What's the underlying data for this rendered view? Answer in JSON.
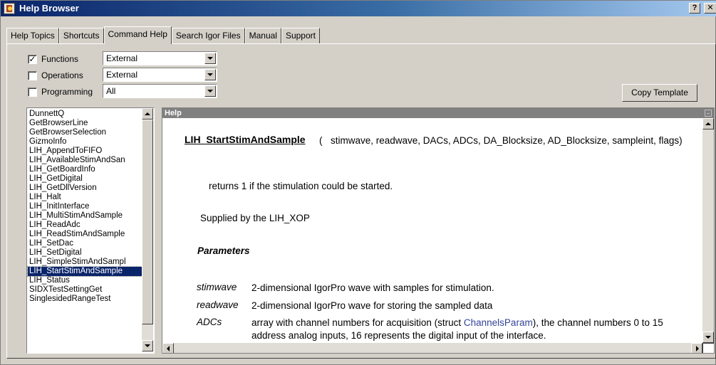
{
  "window": {
    "title": "Help Browser",
    "help_btn": "?",
    "close_btn": "✕"
  },
  "tabs": [
    "Help Topics",
    "Shortcuts",
    "Command Help",
    "Search Igor Files",
    "Manual",
    "Support"
  ],
  "active_tab": "Command Help",
  "filters": [
    {
      "label": "Functions",
      "checked": true,
      "checkmark": "✓",
      "value": "External"
    },
    {
      "label": "Operations",
      "checked": false,
      "checkmark": "",
      "value": "External"
    },
    {
      "label": "Programming",
      "checked": false,
      "checkmark": "",
      "value": "All"
    }
  ],
  "copy_template_label": "Copy Template",
  "list": {
    "items": [
      "DunnettQ",
      "GetBrowserLine",
      "GetBrowserSelection",
      "GizmoInfo",
      "LIH_AppendToFIFO",
      "LIH_AvailableStimAndSan",
      "LIH_GetBoardInfo",
      "LIH_GetDigital",
      "LIH_GetDllVersion",
      "LIH_Halt",
      "LIH_InitInterface",
      "LIH_MultiStimAndSample",
      "LIH_ReadAdc",
      "LIH_ReadStimAndSample",
      "LIH_SetDac",
      "LIH_SetDigital",
      "LIH_SimpleStimAndSampl",
      "LIH_StartStimAndSample",
      "LIH_Status",
      "SIDXTestSettingGet",
      "SinglesidedRangeTest"
    ],
    "selected": "LIH_StartStimAndSample"
  },
  "help": {
    "header": "Help",
    "function_name": "LIH_StartStimAndSample",
    "open_paren": "(",
    "args": "stimwave, readwave, DACs, ADCs, DA_Blocksize, AD_Blocksize, sampleint, flags)",
    "returns": "returns 1 if the stimulation could be started.",
    "supplied": "Supplied by the LIH_XOP",
    "params_heading": "Parameters",
    "params": [
      {
        "name": "stimwave",
        "desc_before": "2-dimensional IgorPro wave with samples for stimulation.",
        "link": "",
        "desc_after": ""
      },
      {
        "name": "readwave",
        "desc_before": "2-dimensional IgorPro wave for storing the sampled data",
        "link": "",
        "desc_after": ""
      },
      {
        "name": "ADCs",
        "desc_before": "array with channel numbers for acquisition (struct ",
        "link": "ChannelsParam",
        "desc_after": "), the channel numbers 0 to 15 address analog inputs, 16 represents the digital input of the interface."
      }
    ]
  }
}
